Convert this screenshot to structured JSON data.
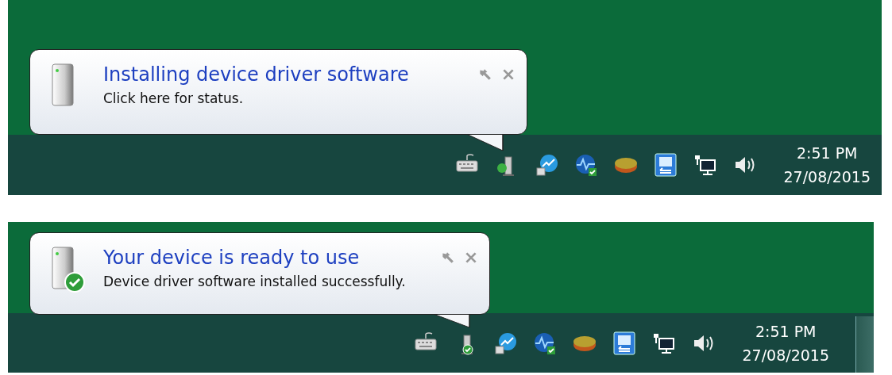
{
  "panels": [
    {
      "installed": false,
      "show_desktop_button": false,
      "balloon": {
        "title": "Installing device driver software",
        "message": "Click here for status."
      },
      "clock": {
        "time": "2:51 PM",
        "date": "27/08/2015"
      }
    },
    {
      "installed": true,
      "show_desktop_button": true,
      "balloon": {
        "title": "Your device is ready to use",
        "message": "Device driver software installed successfully."
      },
      "clock": {
        "time": "2:51 PM",
        "date": "27/08/2015"
      }
    }
  ]
}
